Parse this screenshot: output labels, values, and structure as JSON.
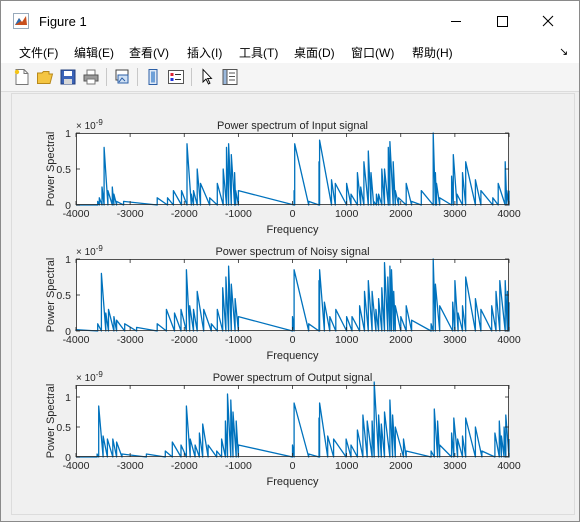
{
  "window": {
    "title": "Figure 1"
  },
  "window_controls": {
    "minimize": "—",
    "maximize": "☐",
    "close": "✕"
  },
  "menu": {
    "items": [
      "文件(F)",
      "编辑(E)",
      "查看(V)",
      "插入(I)",
      "工具(T)",
      "桌面(D)",
      "窗口(W)",
      "帮助(H)"
    ],
    "overflow_arrow": "↘"
  },
  "toolbar": {
    "icons": [
      "new-figure-icon",
      "open-file-icon",
      "save-icon",
      "print-icon",
      "link-plot-icon",
      "insert-colorbar-icon",
      "insert-legend-icon",
      "edit-plot-arrow-icon",
      "property-inspector-icon"
    ]
  },
  "colors": {
    "line": "#0072bd",
    "axes_face": "#ffffff",
    "figure_bg": "#f0f0f0",
    "text": "#262626"
  },
  "chart_data": [
    {
      "type": "line",
      "title": "Power spectrum of Input signal",
      "xlabel": "Frequency",
      "ylabel": "Power Spectral",
      "exponent": "× 10^-9",
      "exponent_base": "× 10",
      "exponent_power": "-9",
      "xlim": [
        -4000,
        4000
      ],
      "ylim": [
        0,
        1e-09
      ],
      "xticks": [
        "-4000",
        "-3000",
        "-2000",
        "-1000",
        "0",
        "1000",
        "2000",
        "3000",
        "4000"
      ],
      "yticks": [
        "0",
        "0.5",
        "1"
      ],
      "x": [
        -4000,
        -3600,
        -3570,
        -3520,
        -3480,
        -3410,
        -3330,
        -3300,
        -3250,
        -3120,
        -2500,
        -2310,
        -2200,
        -2050,
        -1950,
        -1870,
        -1830,
        -1760,
        -1700,
        -1530,
        -1390,
        -1280,
        -1220,
        -1180,
        -1130,
        -1070,
        -1050,
        -1000,
        30,
        40,
        300,
        490,
        500,
        720,
        790,
        1000,
        1080,
        1200,
        1260,
        1320,
        1400,
        1450,
        1500,
        1550,
        1590,
        1650,
        1700,
        1770,
        1800,
        1860,
        1900,
        1960,
        2100,
        2200,
        2380,
        2600,
        2640,
        2660,
        2720,
        2940,
        2970,
        3040,
        3140,
        3200,
        3380,
        3480,
        3700,
        3800,
        3930,
        3960,
        4000
      ],
      "y": [
        0,
        0.05,
        0.1,
        0.25,
        0.8,
        0.2,
        0.25,
        0.15,
        0.05,
        0.05,
        0.1,
        0.1,
        0.2,
        0.2,
        0.85,
        0.15,
        0.2,
        0.5,
        0.3,
        0.1,
        0.3,
        0.5,
        0.8,
        0.85,
        0.7,
        0.45,
        0.2,
        0.2,
        0.2,
        0.85,
        0.05,
        0.6,
        0.9,
        0.35,
        0.3,
        0.3,
        0.15,
        0.45,
        0.25,
        0.6,
        0.75,
        0.45,
        0.05,
        0.15,
        0.15,
        0.5,
        0.5,
        0.8,
        0.88,
        0.6,
        0.2,
        0.1,
        0.3,
        0.05,
        0.2,
        1,
        0.45,
        0.3,
        0.1,
        0.4,
        0.7,
        0.15,
        0.45,
        0.6,
        0.35,
        0.2,
        0.1,
        0.3,
        0.6,
        0.2,
        0.2
      ]
    },
    {
      "type": "line",
      "title": "Power spectrum of Noisy signal",
      "xlabel": "Frequency",
      "ylabel": "Power Spectral",
      "exponent": "× 10^-9",
      "exponent_base": "× 10",
      "exponent_power": "-9",
      "xlim": [
        -4000,
        4000
      ],
      "ylim": [
        0,
        1e-09
      ],
      "xticks": [
        "-4000",
        "-3000",
        "-2000",
        "-1000",
        "0",
        "1000",
        "2000",
        "3000",
        "4000"
      ],
      "yticks": [
        "0",
        "0.5",
        "1"
      ],
      "x": [
        -4000,
        -3600,
        -3530,
        -3450,
        -3400,
        -3300,
        -3250,
        -3100,
        -2880,
        -2500,
        -2330,
        -2180,
        -2060,
        -1960,
        -1900,
        -1830,
        -1760,
        -1640,
        -1500,
        -1390,
        -1290,
        -1230,
        -1180,
        -1130,
        -1060,
        -1000,
        0,
        30,
        300,
        490,
        500,
        590,
        690,
        800,
        1000,
        1100,
        1240,
        1330,
        1400,
        1470,
        1540,
        1590,
        1650,
        1700,
        1760,
        1800,
        1830,
        1870,
        1900,
        2000,
        2100,
        2200,
        2560,
        2600,
        2640,
        2720,
        2960,
        3000,
        3060,
        3140,
        3200,
        3380,
        3480,
        3680,
        3760,
        3830,
        3930,
        3970,
        4000
      ],
      "y": [
        0.02,
        0.1,
        0.8,
        0.25,
        0.3,
        0.2,
        0.15,
        0.1,
        0.05,
        0.1,
        0.3,
        0.25,
        0.3,
        0.85,
        0.35,
        0.3,
        0.55,
        0.3,
        0.1,
        0.3,
        0.6,
        0.75,
        0.9,
        0.65,
        0.45,
        0.2,
        0.2,
        0.85,
        0.1,
        0.7,
        0.85,
        0.4,
        0.2,
        0.3,
        0.2,
        0.2,
        0.35,
        0.55,
        0.7,
        0.55,
        0.3,
        0.45,
        0.6,
        0.95,
        0.75,
        0.9,
        0.85,
        0.55,
        0.35,
        0.2,
        0.35,
        0.15,
        0.1,
        1,
        0.65,
        0.35,
        0.4,
        0.7,
        0.25,
        0.35,
        0.75,
        0.45,
        0.3,
        0.35,
        0.55,
        0.7,
        0.7,
        0.55,
        0.4
      ]
    },
    {
      "type": "line",
      "title": "Power spectrum of Output signal",
      "xlabel": "Frequency",
      "ylabel": "Power Spectral",
      "exponent": "× 10^-9",
      "exponent_base": "× 10",
      "exponent_power": "-9",
      "xlim": [
        -4000,
        4000
      ],
      "ylim": [
        0,
        1.2e-09
      ],
      "xticks": [
        "-4000",
        "-3000",
        "-2000",
        "-1000",
        "0",
        "1000",
        "2000",
        "3000",
        "4000"
      ],
      "yticks": [
        "0",
        "0.5",
        "1"
      ],
      "x": [
        -4000,
        -3610,
        -3580,
        -3500,
        -3420,
        -3320,
        -3250,
        -3150,
        -2700,
        -2350,
        -2220,
        -2060,
        -1960,
        -1890,
        -1800,
        -1720,
        -1660,
        -1560,
        -1400,
        -1310,
        -1240,
        -1200,
        -1140,
        -1100,
        -1040,
        -1000,
        0,
        30,
        300,
        490,
        500,
        650,
        760,
        990,
        1080,
        1200,
        1300,
        1380,
        1470,
        1510,
        1590,
        1640,
        1700,
        1800,
        1850,
        1900,
        2050,
        2100,
        2560,
        2620,
        2680,
        2720,
        2940,
        2980,
        3050,
        3140,
        3200,
        3380,
        3500,
        3740,
        3820,
        3860,
        3910,
        3940,
        4000
      ],
      "y": [
        0,
        0.05,
        0.85,
        0.35,
        0.3,
        0.3,
        0.25,
        0.05,
        0.05,
        0.1,
        0.25,
        0.2,
        0.85,
        0.3,
        0.2,
        0.4,
        0.55,
        0.2,
        0.1,
        0.3,
        0.6,
        1.05,
        0.95,
        0.75,
        0.6,
        0.2,
        0.2,
        0.9,
        0.05,
        0.65,
        0.9,
        0.35,
        0.3,
        0.3,
        0.2,
        0.45,
        0.7,
        0.6,
        0.6,
        1.25,
        0.7,
        0.55,
        0.75,
        0.95,
        0.7,
        0.5,
        0.3,
        0.1,
        0.1,
        0.8,
        0.6,
        0.2,
        0.4,
        0.65,
        0.3,
        0.35,
        0.65,
        0.5,
        0.1,
        0.4,
        0.6,
        0.35,
        0.5,
        0.7,
        0.3
      ]
    }
  ]
}
